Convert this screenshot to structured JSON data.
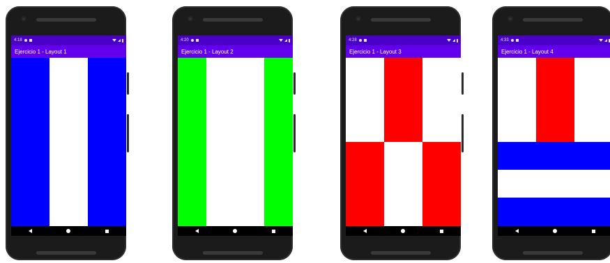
{
  "colors": {
    "app_bar": "#6200ee",
    "status_bar": "#4b00c7",
    "blue": "#0000ff",
    "green": "#00ff00",
    "red": "#ff0000",
    "white": "#ffffff"
  },
  "phones": [
    {
      "status_time": "4:18",
      "app_title": "Ejercicio 1 - Layout 1"
    },
    {
      "status_time": "4:20",
      "app_title": "Ejercicio 1 - Layout 2"
    },
    {
      "status_time": "4:28",
      "app_title": "Ejercicio 1 - Layout 3"
    },
    {
      "status_time": "4:33",
      "app_title": "Ejercicio 1 - Layout 4"
    }
  ]
}
